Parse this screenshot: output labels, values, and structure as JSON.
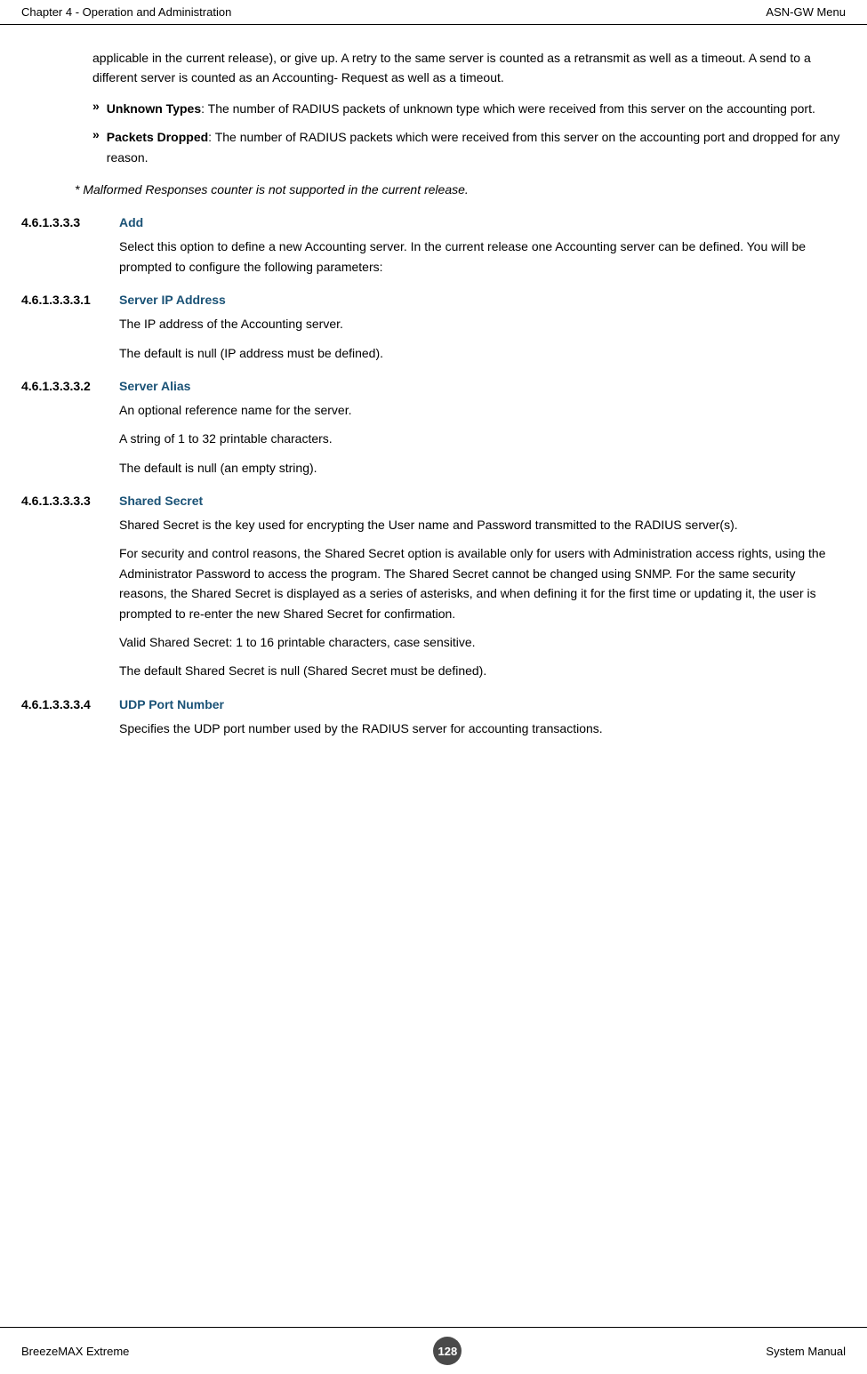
{
  "header": {
    "left": "Chapter 4 - Operation and Administration",
    "right": "ASN-GW Menu"
  },
  "footer": {
    "left": "BreezeMAX Extreme",
    "page": "128",
    "right": "System Manual"
  },
  "content": {
    "intro_paragraph": "applicable in the current release), or give up. A retry to the same server is counted as a retransmit as well as a timeout. A send to a different server is counted as an Accounting- Request as well as a timeout.",
    "bullet1_label": "»",
    "bullet1_bold": "Unknown Types",
    "bullet1_text": ": The number of RADIUS packets of unknown type which were received from this server on the accounting port.",
    "bullet2_label": "»",
    "bullet2_bold": "Packets Dropped",
    "bullet2_text": ": The number of RADIUS packets which were received from this server on the accounting port and dropped for any reason.",
    "note": "* Malformed Responses counter is not supported in the current release.",
    "section_433": {
      "num": "4.6.1.3.3.3",
      "title": "Add",
      "body": "Select this option to define a new Accounting server. In the current release one Accounting server can be defined. You will be prompted to configure the following parameters:"
    },
    "section_4331": {
      "num": "4.6.1.3.3.3.1",
      "title": "Server IP Address",
      "para1": "The IP address of the Accounting server.",
      "para2": "The default is null (IP address must be defined)."
    },
    "section_4332": {
      "num": "4.6.1.3.3.3.2",
      "title": "Server Alias",
      "para1": "An optional reference name for the server.",
      "para2": "A string of 1 to 32 printable characters.",
      "para3": "The default is null (an empty string)."
    },
    "section_4333": {
      "num": "4.6.1.3.3.3.3",
      "title": "Shared Secret",
      "para1": "Shared Secret is the key used for encrypting the User name and Password transmitted to the RADIUS server(s).",
      "para2": "For security and control reasons, the Shared Secret option is available only for users with Administration access rights, using the Administrator Password to access the program. The Shared Secret cannot be changed using SNMP. For the same security reasons, the Shared Secret is displayed as a series of asterisks, and when defining it for the first time or updating it, the user is prompted to re-enter the new Shared Secret for confirmation.",
      "para3": "Valid Shared Secret: 1 to 16 printable characters, case sensitive.",
      "para4": "The default Shared Secret is null (Shared Secret must be defined)."
    },
    "section_4334": {
      "num": "4.6.1.3.3.3.4",
      "title": "UDP Port Number",
      "para1": "Specifies the UDP port number used by the RADIUS server for accounting transactions."
    }
  }
}
